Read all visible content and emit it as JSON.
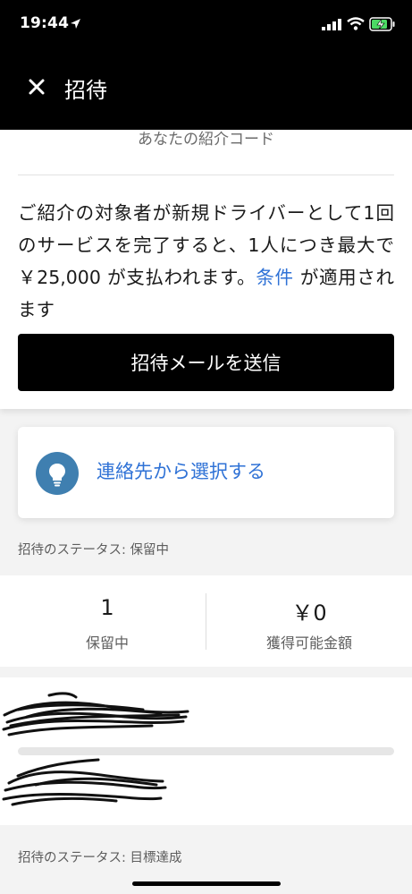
{
  "status_bar": {
    "time": "19:44"
  },
  "header": {
    "title": "招待"
  },
  "referral": {
    "code_label": "あなたの紹介コード",
    "description_before": "ご紹介の対象者が新規ドライバーとして1回のサービスを完了すると、1人につき最大で ￥25,000 が支払われます。",
    "terms_link": "条件",
    "description_after": " が適用されます",
    "send_button": "招待メールを送信"
  },
  "contacts": {
    "label": "連絡先から選択する"
  },
  "status_pending": "招待のステータス: 保留中",
  "stats": {
    "left": {
      "value": "1",
      "label": "保留中"
    },
    "right": {
      "value": "￥0",
      "label": "獲得可能金額"
    }
  },
  "status_achieved": "招待のステータス: 目標達成",
  "colors": {
    "link": "#2f72d6",
    "header_bg": "#000000",
    "bulb_circle": "#3f7fb0"
  },
  "icons": [
    "location-arrow-icon",
    "signal-icon",
    "wifi-icon",
    "battery-charging-icon",
    "close-icon",
    "lightbulb-icon"
  ]
}
